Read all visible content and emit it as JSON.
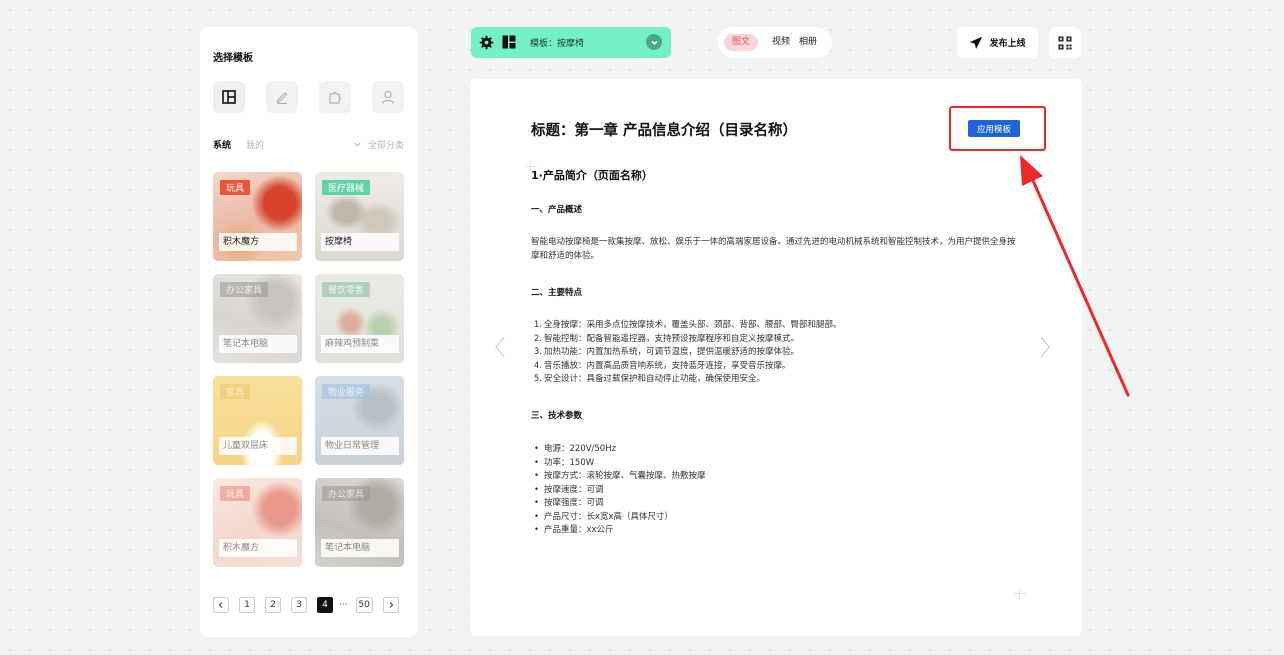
{
  "sidebar": {
    "title": "选择模板",
    "tools": [
      "layout-icon",
      "edit-icon",
      "puzzle-icon",
      "user-icon"
    ],
    "filter": {
      "system": "系统",
      "mine": "我的",
      "all": "全部分类"
    },
    "cards": [
      {
        "tag": "玩具",
        "name": "积木魔方",
        "tag_color": "#e8553a"
      },
      {
        "tag": "医疗器械",
        "name": "按摩椅",
        "tag_color": "#5fd3a8"
      },
      {
        "tag": "办公家具",
        "name": "笔记本电脑",
        "tag_color": "#9a9a9a"
      },
      {
        "tag": "餐饮零售",
        "name": "麻辣鸡预制菜",
        "tag_color": "#8dc2a0"
      },
      {
        "tag": "家具",
        "name": "儿童双层床",
        "tag_color": "#f1c86a"
      },
      {
        "tag": "物业服务",
        "name": "物业日常管理",
        "tag_color": "#9fc3e8"
      },
      {
        "tag": "玩具",
        "name": "积木魔方",
        "tag_color": "#f08a78"
      },
      {
        "tag": "办公家具",
        "name": "笔记本电脑",
        "tag_color": "#9a9a9a"
      }
    ],
    "pagination": {
      "pages": [
        "1",
        "2",
        "3",
        "4"
      ],
      "current": "4",
      "ellipsis": "···",
      "last": "50"
    }
  },
  "topbar": {
    "template_label": "模板：按摩椅",
    "tabs": [
      "图文",
      "视频",
      "相册"
    ],
    "active_tab": "图文",
    "publish": "发布上线"
  },
  "document": {
    "title": "标题：第一章 产品信息介绍（目录名称）",
    "apply_button": "应用模板",
    "page_name": "1·产品简介（页面名称）",
    "sections": {
      "overview_head": "一、产品概述",
      "overview_text": "智能电动按摩椅是一款集按摩、放松、娱乐于一体的高端家居设备。通过先进的电动机械系统和智能控制技术，为用户提供全身按摩和舒适的体验。",
      "features_head": "二、主要特点",
      "features": [
        "全身按摩：采用多点位按摩技术，覆盖头部、颈部、背部、腰部、臀部和腿部。",
        "智能控制：配备智能遥控器，支持预设按摩程序和自定义按摩模式。",
        "加热功能：内置加热系统，可调节温度，提供温暖舒适的按摩体验。",
        "音乐播放：内置高品质音响系统，支持蓝牙连接，享受音乐按摩。",
        "安全设计：具备过载保护和自动停止功能，确保使用安全。"
      ],
      "params_head": "三、技术参数",
      "params": [
        "电源：220V/50Hz",
        "功率：150W",
        "按摩方式：滚轮按摩、气囊按摩、热敷按摩",
        "按摩速度：可调",
        "按摩强度：可调",
        "产品尺寸：长x宽x高（具体尺寸）",
        "产品重量：xx公斤"
      ]
    }
  },
  "colors": {
    "accent_green": "#74f0c8",
    "accent_blue": "#1e63d9",
    "annotation_red": "#ea2a2a",
    "active_tab_pink": "#fbd6da"
  }
}
